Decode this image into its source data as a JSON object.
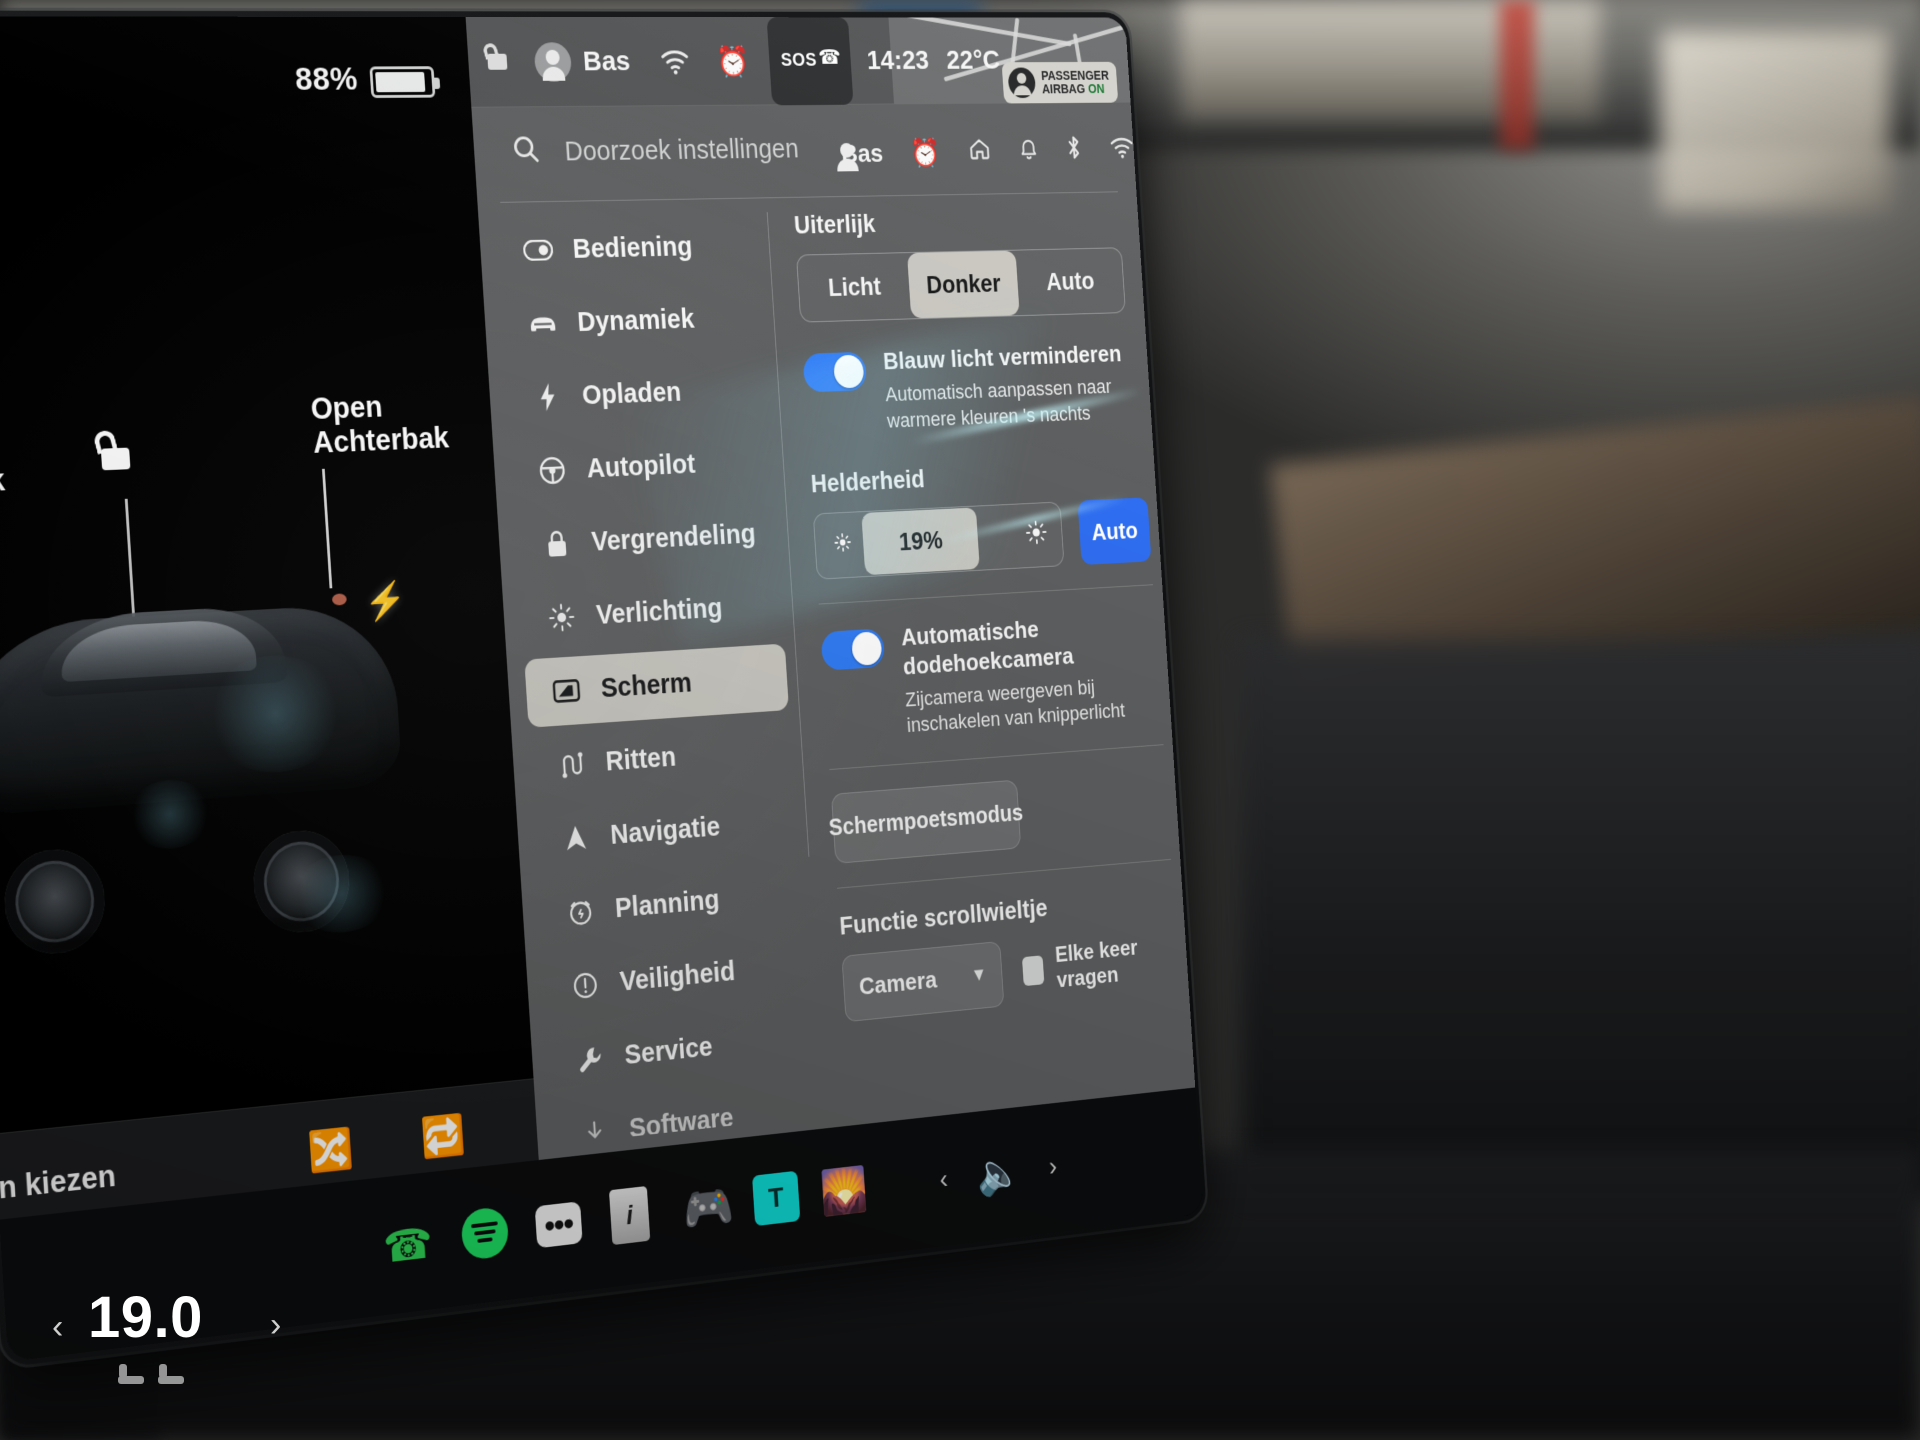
{
  "car_panel": {
    "battery_percent": "88%",
    "callout_rear": "Open\nAchterbak",
    "callout_rear_line1": "Open",
    "callout_rear_line2": "Achterbak",
    "callout_left": "bak",
    "media_source_label": "ron kiezen",
    "icons": {
      "lock_open": "unlock-icon",
      "charge_bolt": "charge-bolt-icon",
      "shuffle": "shuffle-icon",
      "repeat": "repeat-icon",
      "next_track": "next-track-icon",
      "add": "add-circle-icon",
      "equalizer": "equalizer-icon",
      "search": "search-icon"
    }
  },
  "status_bar": {
    "lock_icon": "unlock-icon",
    "profile_name": "Bas",
    "wifi_icon": "wifi-icon",
    "alarm_icon": "alarm-clock-icon",
    "sos_label": "SOS",
    "time": "14:23",
    "temperature": "22°C"
  },
  "airbag_badge": {
    "line1": "PASSENGER",
    "line2": "AIRBAG",
    "state": "ON"
  },
  "search": {
    "placeholder": "Doorzoek instellingen",
    "value": "",
    "icon": "search-icon"
  },
  "profile_row": {
    "name": "Bas",
    "icons": [
      "alarm-clock-icon",
      "home-icon",
      "bell-icon",
      "bluetooth-icon",
      "wifi-icon"
    ]
  },
  "sidebar": {
    "items": [
      {
        "label": "Bediening",
        "icon": "toggle-switch-icon",
        "active": false
      },
      {
        "label": "Dynamiek",
        "icon": "car-front-icon",
        "active": false
      },
      {
        "label": "Opladen",
        "icon": "lightning-bolt-icon",
        "active": false
      },
      {
        "label": "Autopilot",
        "icon": "steering-wheel-icon",
        "active": false
      },
      {
        "label": "Vergrendeling",
        "icon": "lock-closed-icon",
        "active": false
      },
      {
        "label": "Verlichting",
        "icon": "brightness-icon",
        "active": false
      },
      {
        "label": "Scherm",
        "icon": "display-icon",
        "active": true
      },
      {
        "label": "Ritten",
        "icon": "road-trip-icon",
        "active": false
      },
      {
        "label": "Navigatie",
        "icon": "navigation-arrow-icon",
        "active": false
      },
      {
        "label": "Planning",
        "icon": "schedule-clock-icon",
        "active": false
      },
      {
        "label": "Veiligheid",
        "icon": "alert-circle-icon",
        "active": false
      },
      {
        "label": "Service",
        "icon": "wrench-icon",
        "active": false
      },
      {
        "label": "Software",
        "icon": "download-icon",
        "active": false
      }
    ]
  },
  "display_settings": {
    "appearance": {
      "title": "Uiterlijk",
      "options": [
        "Licht",
        "Donker",
        "Auto"
      ],
      "selected": "Donker"
    },
    "blue_light": {
      "title": "Blauw licht verminderen",
      "subtitle": "Automatisch aanpassen naar warmere kleuren 's nachts",
      "enabled": true
    },
    "brightness": {
      "title": "Helderheid",
      "value": "19%",
      "percent": 19,
      "auto_label": "Auto",
      "low_icon": "brightness-low-icon",
      "high_icon": "brightness-high-icon"
    },
    "blind_spot": {
      "title": "Automatische dodehoekcamera",
      "subtitle": "Zijcamera weergeven bij inschakelen van knipperlicht",
      "enabled": true
    },
    "clean_mode": {
      "label": "Schermpoetsmodus"
    },
    "scroll_wheel": {
      "title": "Functie scrollwieltje",
      "selected": "Camera",
      "chevron": "chevron-down-icon",
      "checkbox_label": "Elke keer vragen",
      "checkbox_checked": false
    }
  },
  "dock": {
    "apps": [
      {
        "name": "phone-icon",
        "label": "Telefoon"
      },
      {
        "name": "spotify-icon",
        "label": "Spotify"
      },
      {
        "name": "more-dots-icon",
        "label": "Meer"
      },
      {
        "name": "news-icon",
        "label": "Nieuws"
      },
      {
        "name": "joystick-icon",
        "label": "Arcade"
      },
      {
        "name": "tidal-icon",
        "label": "Tidal"
      },
      {
        "name": "photos-icon",
        "label": "Foto's"
      }
    ],
    "volume_icon": "volume-icon",
    "prev_arrow": "chevron-left-icon",
    "next_arrow": "chevron-right-icon"
  },
  "climate": {
    "temperature": "19.0",
    "left_arrow": "chevron-left-icon",
    "right_arrow": "chevron-right-icon",
    "seat_icons": [
      "seat-heater-icon",
      "seat-heater-icon"
    ]
  },
  "colors": {
    "accent_blue": "#2f7cf6",
    "auto_button_blue": "#2f6ef0",
    "selected_pill": "#c9c7c0",
    "panel_bg": "#5d5f60",
    "alarm_amber": "#f0c330",
    "spotify_green": "#1ed760",
    "tidal_cyan": "#0fd5d0",
    "airbag_on_green": "#1b7a35"
  }
}
